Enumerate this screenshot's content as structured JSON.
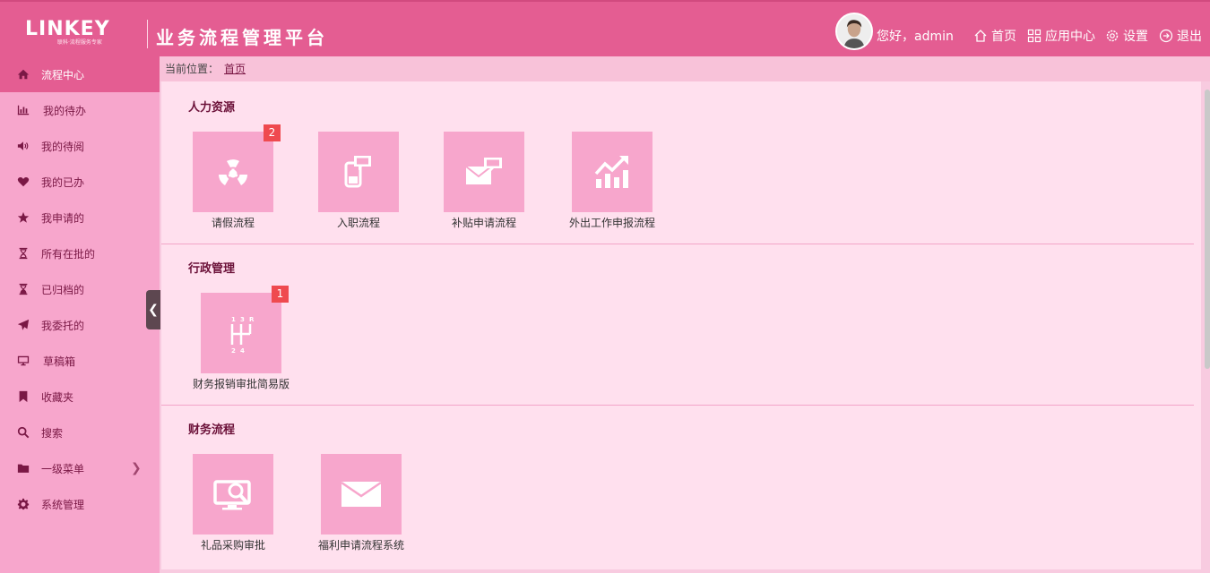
{
  "header": {
    "logo_text": "LINKEY",
    "logo_sub": "联科·流程服务专家",
    "app_title": "业务流程管理平台",
    "greeting": "您好，admin",
    "nav": [
      {
        "label": "首页",
        "icon": "home-icon"
      },
      {
        "label": "应用中心",
        "icon": "grid-icon"
      },
      {
        "label": "设置",
        "icon": "gear-icon"
      },
      {
        "label": "退出",
        "icon": "logout-icon"
      }
    ]
  },
  "sidebar": {
    "items": [
      {
        "label": "流程中心",
        "icon": "home-icon",
        "active": true
      },
      {
        "label": "我的待办",
        "icon": "bar-chart-icon"
      },
      {
        "label": "我的待阅",
        "icon": "volume-icon"
      },
      {
        "label": "我的已办",
        "icon": "heart-icon"
      },
      {
        "label": "我申请的",
        "icon": "star-icon"
      },
      {
        "label": "所有在批的",
        "icon": "hourglass-icon"
      },
      {
        "label": "已归档的",
        "icon": "hourglass-icon"
      },
      {
        "label": "我委托的",
        "icon": "send-icon"
      },
      {
        "label": "草稿箱",
        "icon": "monitor-icon"
      },
      {
        "label": "收藏夹",
        "icon": "bookmark-icon"
      },
      {
        "label": "搜索",
        "icon": "search-icon"
      },
      {
        "label": "一级菜单",
        "icon": "folder-icon"
      },
      {
        "label": "系统管理",
        "icon": "gear-icon"
      }
    ]
  },
  "breadcrumb": {
    "prefix": "当前位置：",
    "current": "首页"
  },
  "sections": [
    {
      "title": "人力资源",
      "apps": [
        {
          "label": "请假流程",
          "icon": "radiation-icon",
          "badge": "2"
        },
        {
          "label": "入职流程",
          "icon": "phone-chat-icon"
        },
        {
          "label": "补贴申请流程",
          "icon": "mail-chat-icon"
        },
        {
          "label": "外出工作申报流程",
          "icon": "growth-chart-icon"
        }
      ]
    },
    {
      "title": "行政管理",
      "apps": [
        {
          "label": "财务报销审批简易版",
          "icon": "gear-shift-icon",
          "badge": "1"
        }
      ]
    },
    {
      "title": "财务流程",
      "apps": [
        {
          "label": "礼品采购审批",
          "icon": "monitor-search-icon"
        },
        {
          "label": "福利申请流程系统",
          "icon": "envelope-icon"
        }
      ]
    }
  ],
  "gear_shift_digits": [
    "1",
    "3",
    "R",
    "2",
    "4"
  ],
  "colors": {
    "header": "#e45d92",
    "sidebar": "#f7a6cc",
    "tile": "#f7a6cc",
    "badge": "#ef4a4f"
  }
}
